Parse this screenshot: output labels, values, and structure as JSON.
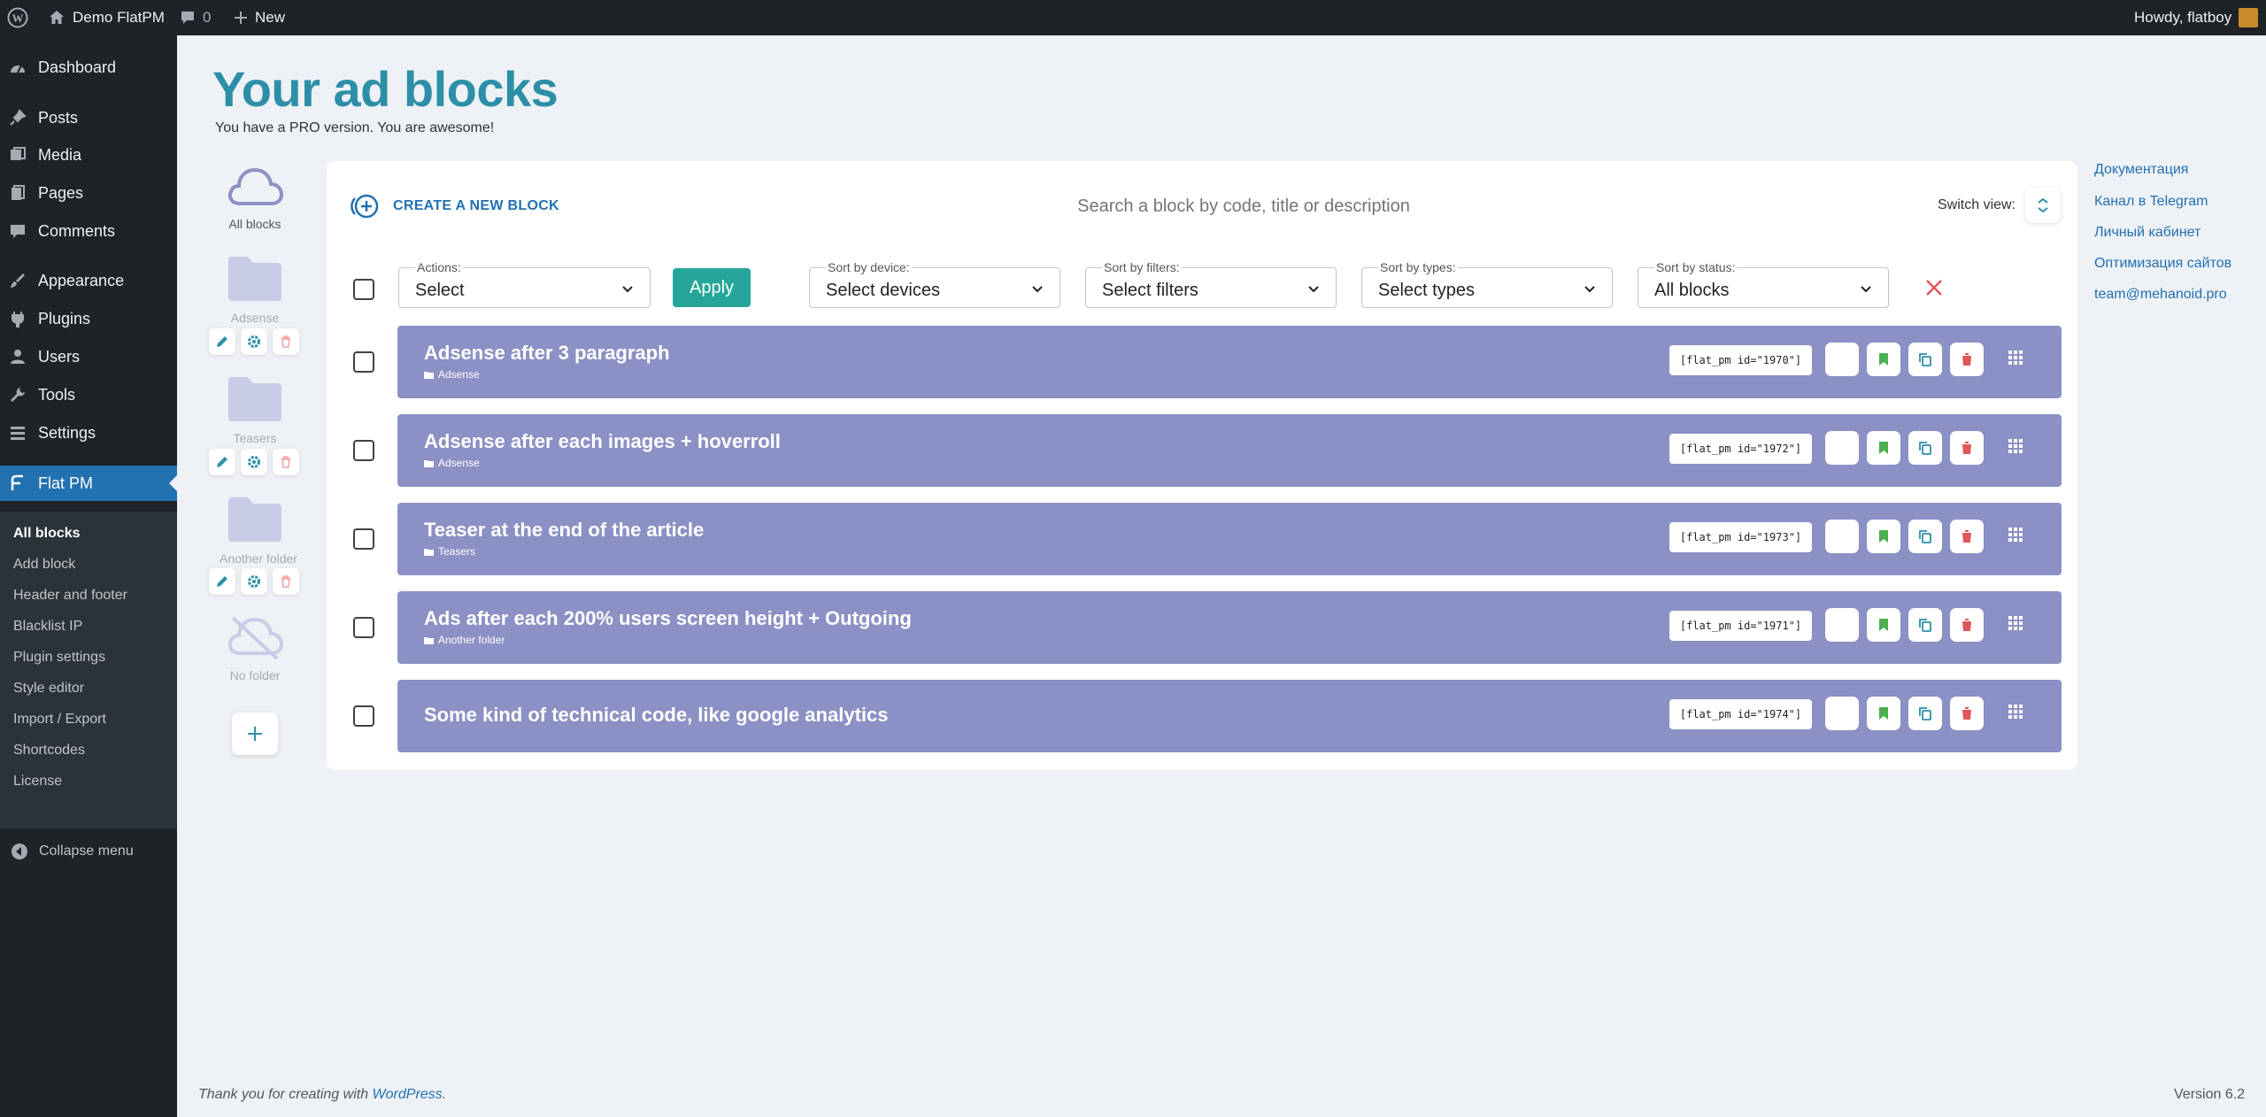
{
  "adminbar": {
    "site_name": "Demo FlatPM",
    "comments_count": "0",
    "new_label": "New",
    "howdy": "Howdy, flatboy"
  },
  "sidebar": {
    "items": [
      {
        "label": "Dashboard",
        "icon": "dashboard-icon"
      },
      {
        "label": "Posts",
        "icon": "pin-icon"
      },
      {
        "label": "Media",
        "icon": "media-icon"
      },
      {
        "label": "Pages",
        "icon": "pages-icon"
      },
      {
        "label": "Comments",
        "icon": "comment-icon"
      },
      {
        "label": "Appearance",
        "icon": "brush-icon"
      },
      {
        "label": "Plugins",
        "icon": "plugin-icon"
      },
      {
        "label": "Users",
        "icon": "user-icon"
      },
      {
        "label": "Tools",
        "icon": "wrench-icon"
      },
      {
        "label": "Settings",
        "icon": "settings-icon"
      },
      {
        "label": "Flat PM",
        "icon": "flatpm-icon"
      }
    ],
    "submenu": [
      "All blocks",
      "Add block",
      "Header and footer",
      "Blacklist IP",
      "Plugin settings",
      "Style editor",
      "Import / Export",
      "Shortcodes",
      "License"
    ],
    "collapse": "Collapse menu"
  },
  "page": {
    "title": "Your ad blocks",
    "subtitle": "You have a PRO version. You are awesome!"
  },
  "folders": [
    {
      "label": "All blocks"
    },
    {
      "label": "Adsense"
    },
    {
      "label": "Teasers"
    },
    {
      "label": "Another folder"
    },
    {
      "label": "No folder"
    }
  ],
  "toolbar": {
    "create_label": "CREATE A NEW BLOCK",
    "search_placeholder": "Search a block by code, title or description",
    "switch_view": "Switch view:"
  },
  "filters": {
    "actions": {
      "label": "Actions:",
      "value": "Select"
    },
    "apply": "Apply",
    "device": {
      "label": "Sort by device:",
      "value": "Select devices"
    },
    "filters": {
      "label": "Sort by filters:",
      "value": "Select filters"
    },
    "types": {
      "label": "Sort by types:",
      "value": "Select types"
    },
    "status": {
      "label": "Sort by status:",
      "value": "All blocks"
    }
  },
  "blocks": [
    {
      "title": "Adsense after 3 paragraph",
      "folder": "Adsense",
      "shortcode": "[flat_pm id=\"1970\"]"
    },
    {
      "title": "Adsense after each images + hoverroll",
      "folder": "Adsense",
      "shortcode": "[flat_pm id=\"1972\"]"
    },
    {
      "title": "Teaser at the end of the article",
      "folder": "Teasers",
      "shortcode": "[flat_pm id=\"1973\"]"
    },
    {
      "title": "Ads after each 200% users screen height + Outgoing",
      "folder": "Another folder",
      "shortcode": "[flat_pm id=\"1971\"]"
    },
    {
      "title": "Some kind of technical code, like google analytics",
      "folder": "",
      "shortcode": "[flat_pm id=\"1974\"]"
    }
  ],
  "links": [
    "Документация",
    "Канал в Telegram",
    "Личный кабинет",
    "Оптимизация сайтов",
    "team@mehanoid.pro"
  ],
  "footer": {
    "text": "Thank you for creating with ",
    "link": "WordPress",
    "period": ".",
    "version": "Version 6.2"
  },
  "colors": {
    "accent": "#2d8fa7",
    "row": "#8b91c4",
    "apply": "#26a69a",
    "admin_dark": "#1d2327",
    "menu_active": "#2271b1"
  }
}
